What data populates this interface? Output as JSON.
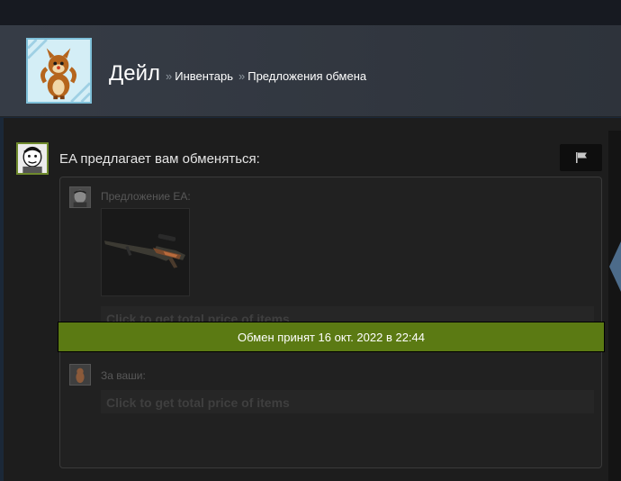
{
  "header": {
    "profile_name": "Дейл",
    "separator": "»",
    "breadcrumb_inventory": "Инвентарь",
    "breadcrumb_offers": "Предложения обмена"
  },
  "trade": {
    "title": "EA предлагает вам обменяться:",
    "their_label": "Предложение EA:",
    "your_label": "За ваши:",
    "price_button": "Click to get total price of items",
    "status": "Обмен принят 16 окт. 2022 в 22:44"
  },
  "icons": {
    "flag": "flag-icon"
  },
  "colors": {
    "banner_accepted": "#5b7a13",
    "header_bg": "#363c46",
    "page_bg": "#1d1d1d"
  }
}
